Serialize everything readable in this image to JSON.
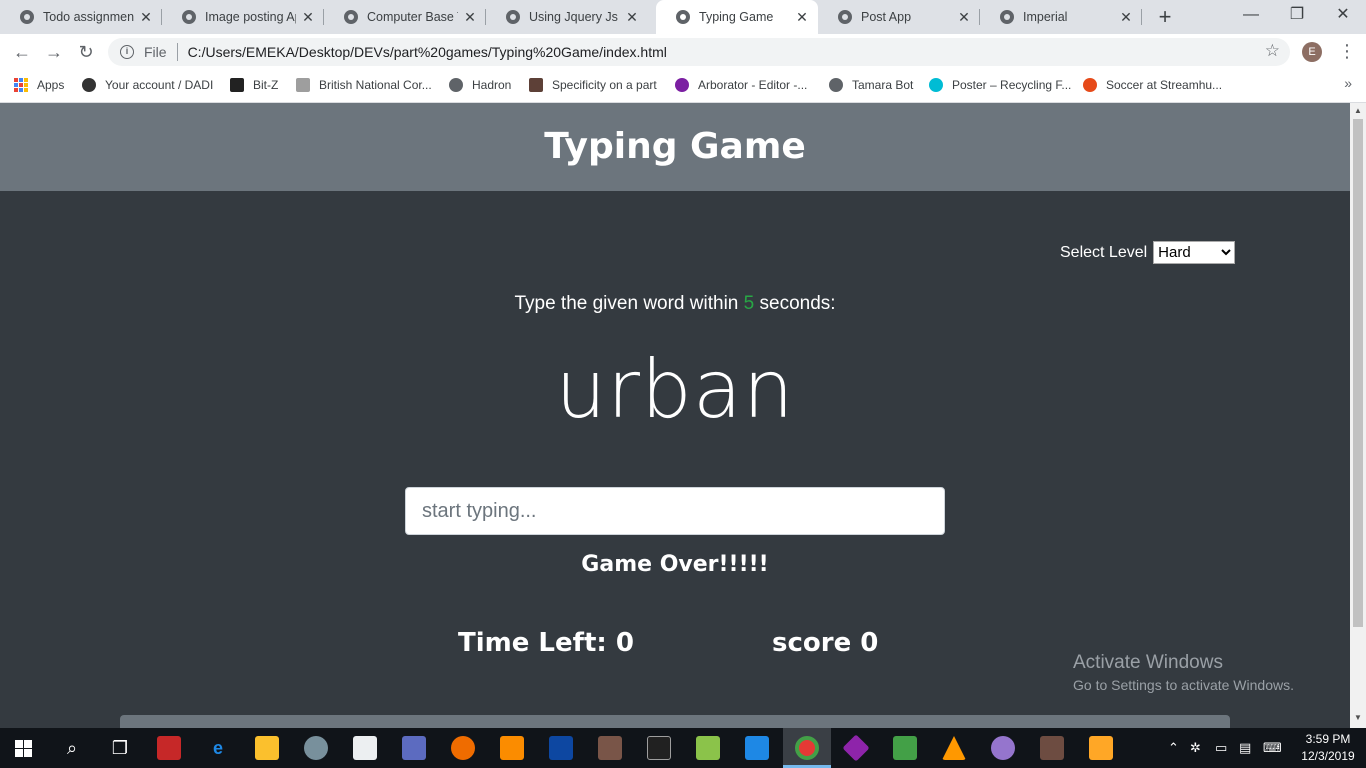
{
  "browser": {
    "tabs": [
      {
        "label": "Todo assignment",
        "active": false
      },
      {
        "label": "Image posting App",
        "active": false
      },
      {
        "label": "Computer Base Test",
        "active": false
      },
      {
        "label": "Using Jquery Js library",
        "active": false
      },
      {
        "label": "Typing Game",
        "active": true
      },
      {
        "label": "Post App",
        "active": false
      },
      {
        "label": "Imperial",
        "active": false
      }
    ],
    "address": {
      "scheme_label": "File",
      "url": "C:/Users/EMEKA/Desktop/DEVs/part%20games/Typing%20Game/index.html"
    },
    "profile_initial": "E",
    "bookmarks": [
      "Apps",
      "Your account / DADI",
      "Bit-Z",
      "British National Cor...",
      "Hadron",
      "Specificity on a part",
      "Arborator - Editor -...",
      "Tamara Bot",
      "Poster – Recycling F...",
      "Soccer at Streamhu..."
    ]
  },
  "game": {
    "title": "Typing Game",
    "level_label": "Select Level",
    "level_value": "Hard",
    "instruction_prefix": "Type the given word within ",
    "seconds": "5",
    "instruction_suffix": " seconds:",
    "current_word": "urban",
    "input_placeholder": "start typing...",
    "message": "Game Over!!!!!",
    "time_left_label": "Time Left: ",
    "time_left": "0",
    "score_label": "score ",
    "score": "0"
  },
  "watermark": {
    "line1": "Activate Windows",
    "line2": "Go to Settings to activate Windows."
  },
  "taskbar": {
    "time": "3:59 PM",
    "date": "12/3/2019"
  },
  "colors": {
    "header_bg": "#6c757d",
    "page_bg": "#343a40",
    "seconds_accent": "#28a745"
  }
}
